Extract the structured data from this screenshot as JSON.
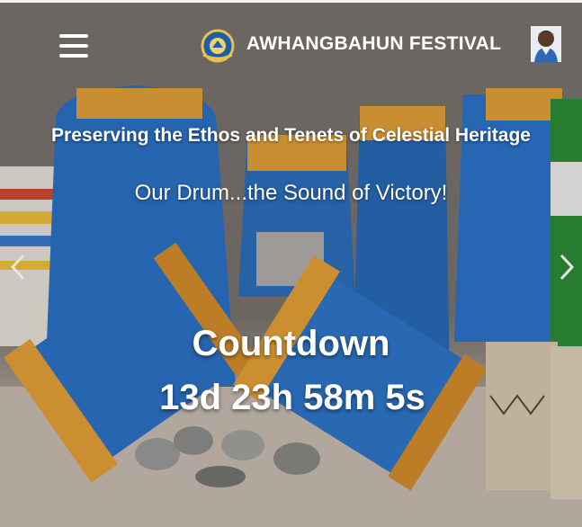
{
  "header": {
    "brand_title": "AWHANGBAHUN FESTIVAL",
    "menu_icon": "hamburger-menu-icon",
    "logo_icon": "festival-emblem-icon",
    "avatar_icon": "person-avatar-icon"
  },
  "hero": {
    "tagline": "Preserving the Ethos and Tenets of Celestial Heritage",
    "subtitle": "Our Drum...the Sound of Victory!",
    "prev_icon": "chevron-left-icon",
    "next_icon": "chevron-right-icon"
  },
  "countdown": {
    "title": "Countdown",
    "time": "13d 23h 58m 5s"
  },
  "colors": {
    "drum_blue": "#2a73c8",
    "drum_orange": "#e0962e",
    "text": "#ffffff"
  }
}
